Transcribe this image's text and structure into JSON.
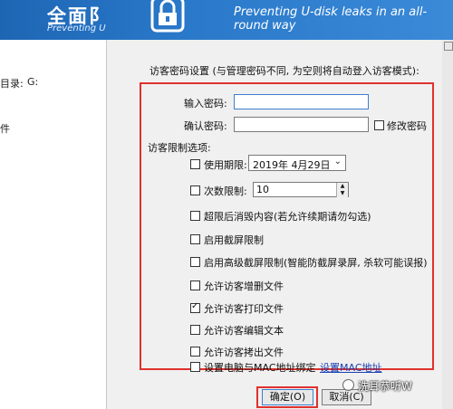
{
  "banner": {
    "title": "全面阝",
    "subtitle_left": "Preventing U",
    "subtitle_right": "Preventing U-disk leaks in an all-round way"
  },
  "background": {
    "dir_label": "目录:",
    "dir_value": "G:",
    "side_char": "件"
  },
  "dialog": {
    "guest_password_title": "访客密码设置 (与管理密码不同, 为空则将自动登入访客模式):",
    "input_password_label": "输入密码:",
    "input_password_value": "",
    "confirm_password_label": "确认密码:",
    "confirm_password_value": "",
    "modify_password_label": "修改密码",
    "modify_password_checked": false,
    "restrictions_label": "访客限制选项:",
    "options": [
      {
        "label": "使用期限:",
        "checked": false
      },
      {
        "label": "次数限制:",
        "checked": false
      },
      {
        "label": "超限后消毁内容(若允许续期请勿勾选)",
        "checked": false
      },
      {
        "label": "启用截屏限制",
        "checked": false
      },
      {
        "label": "启用高级截屏限制(智能防截屏录屏, 杀软可能误报)",
        "checked": false
      },
      {
        "label": "允许访客增删文件",
        "checked": false
      },
      {
        "label": "允许访客打印文件",
        "checked": true
      },
      {
        "label": "允许访客编辑文本",
        "checked": false
      },
      {
        "label": "允许访客拷出文件",
        "checked": false
      },
      {
        "label": "设置电脑与MAC地址绑定",
        "checked": false
      }
    ],
    "date_value": "2019年  4月29日",
    "count_value": "10",
    "mac_link": "设置MAC地址",
    "ok_button": "确定(O)",
    "cancel_button": "取消(C)"
  },
  "watermark": "洗耳恭听W",
  "colors": {
    "highlight_frame": "#e0312d",
    "banner": "#2a78c9",
    "link": "#1a3fb0"
  }
}
